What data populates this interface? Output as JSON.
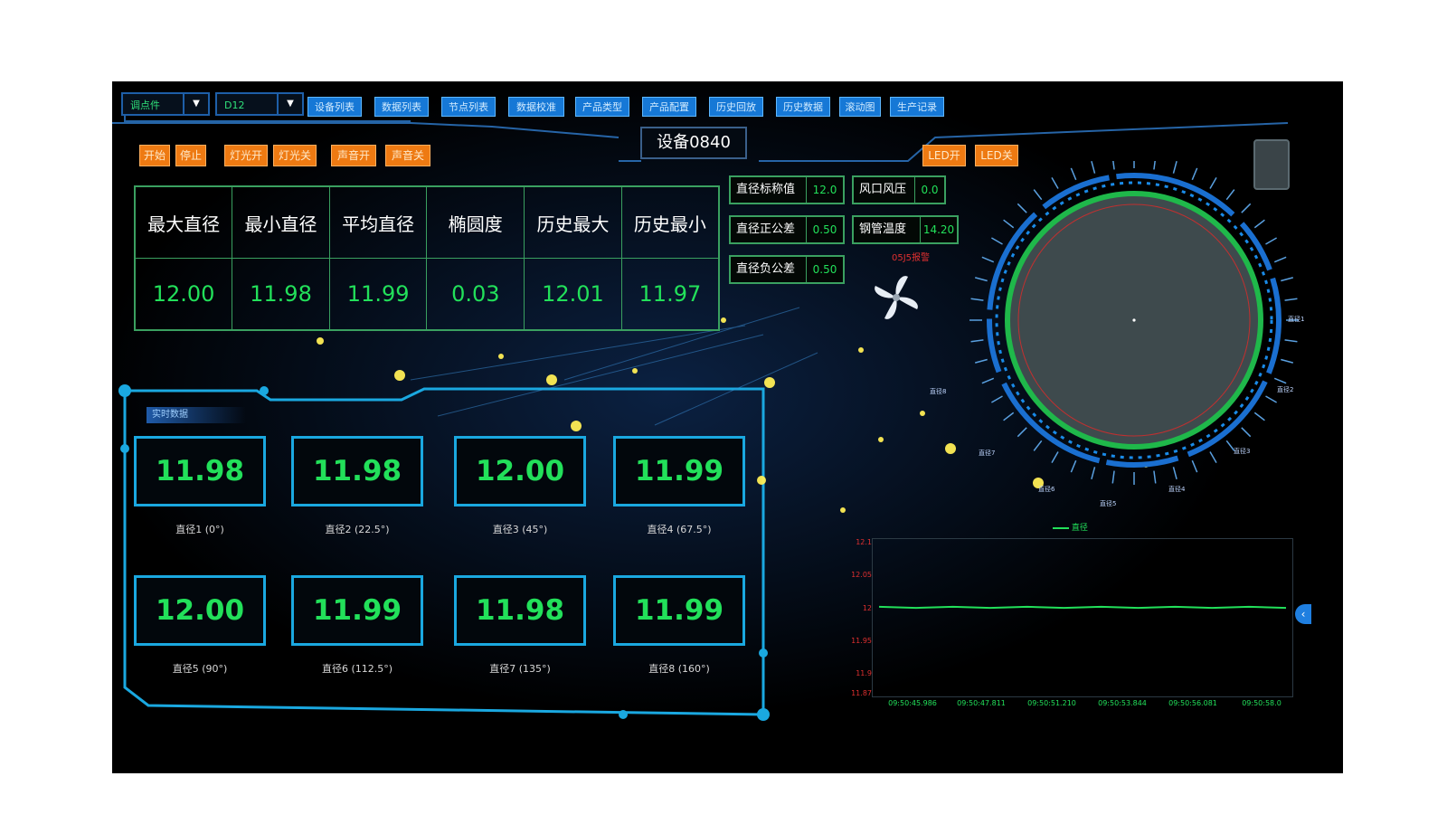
{
  "header": {
    "mode_select": "调点件",
    "device_select": "D12",
    "device_title": "设备0840"
  },
  "nav_buttons": [
    "设备列表",
    "数据列表",
    "节点列表",
    "数据校准",
    "产品类型",
    "产品配置",
    "历史回放",
    "历史数据",
    "滚动图",
    "生产记录"
  ],
  "controls": {
    "start": "开始",
    "stop": "停止",
    "light_on": "灯光开",
    "light_off": "灯光关",
    "sound_on": "声音开",
    "sound_off": "声音关",
    "led_on": "LED开",
    "led_off": "LED关"
  },
  "stats": {
    "headers": [
      "最大直径",
      "最小直径",
      "平均直径",
      "椭圆度",
      "历史最大",
      "历史最小"
    ],
    "values": [
      "12.00",
      "11.98",
      "11.99",
      "0.03",
      "12.01",
      "11.97"
    ]
  },
  "params": [
    {
      "label": "直径标称值",
      "value": "12.0"
    },
    {
      "label": "直径正公差",
      "value": "0.50"
    },
    {
      "label": "直径负公差",
      "value": "0.50"
    },
    {
      "label": "风口风压",
      "value": "0.0"
    },
    {
      "label": "钢管温度",
      "value": "14.20"
    }
  ],
  "alarm_text": "05J5报警",
  "realtime": {
    "title": "实时数据",
    "cells": [
      {
        "value": "11.98",
        "label": "直径1 (0°)"
      },
      {
        "value": "11.98",
        "label": "直径2 (22.5°)"
      },
      {
        "value": "12.00",
        "label": "直径3 (45°)"
      },
      {
        "value": "11.99",
        "label": "直径4 (67.5°)"
      },
      {
        "value": "12.00",
        "label": "直径5 (90°)"
      },
      {
        "value": "11.99",
        "label": "直径6 (112.5°)"
      },
      {
        "value": "11.98",
        "label": "直径7 (135°)"
      },
      {
        "value": "11.99",
        "label": "直径8 (160°)"
      }
    ]
  },
  "gauge": {
    "labels": [
      "直径1",
      "直径2",
      "直径3",
      "直径4",
      "直径5",
      "直径6",
      "直径7",
      "直径8"
    ]
  },
  "colors": {
    "accent_blue": "#1aa8e0",
    "value_green": "#22e05a",
    "button_orange": "#ee7a12",
    "nav_blue": "#1678d6"
  },
  "chart_data": {
    "type": "line",
    "series": [
      {
        "name": "直径",
        "values": [
          12.0,
          12.0,
          12.0,
          12.0,
          12.0,
          12.0,
          12.0,
          12.0,
          12.0,
          12.0,
          12.0,
          12.0
        ]
      }
    ],
    "x": [
      "09:50:45.986",
      "09:50:47.811",
      "09:50:51.210",
      "09:50:53.844",
      "09:50:56.081",
      "09:50:58.0"
    ],
    "y_ticks": [
      "12.1",
      "12.05",
      "12",
      "11.95",
      "11.9",
      "11.87"
    ],
    "ylim": [
      11.87,
      12.1
    ],
    "grid": false,
    "legend": "top"
  }
}
